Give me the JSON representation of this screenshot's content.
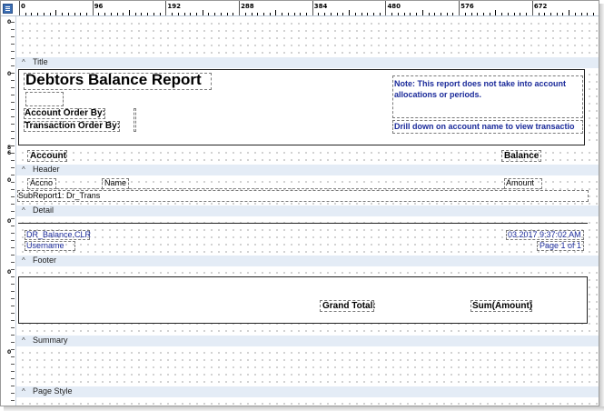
{
  "ruler": {
    "labels": [
      "0",
      "96",
      "192",
      "288",
      "384",
      "480",
      "576",
      "672"
    ]
  },
  "bands": {
    "title": "Title",
    "header": "Header",
    "detail": "Detail",
    "footer": "Footer",
    "summary": "Summary",
    "page_style": "Page Style"
  },
  "title_band": {
    "report_title": "Debtors Balance Report",
    "account_order_by": "Account Order By:",
    "transaction_order_by": "Transaction Order By:",
    "note": "Note:  This report does not take into account allocations or periods.",
    "drill_down": "Drill down on account name to view transactio"
  },
  "header_band": {
    "account": "Account",
    "balance": "Balance"
  },
  "detail_band": {
    "accno": "Accno",
    "name": "Name",
    "amount": "Amount",
    "subreport": "SubReport1: Dr_Trans"
  },
  "footer_band": {
    "report_file": "DR_Balance.CLR",
    "username": "Username",
    "datetime": "03.2017 9:37:02 AM",
    "page": "Page 1 of 1"
  },
  "summary_band": {
    "grand_total": "Grand Total:",
    "sum_amount": "Sum(Amount)"
  },
  "vruler": {
    "zero": "0",
    "eight": "8",
    "six": "6"
  }
}
